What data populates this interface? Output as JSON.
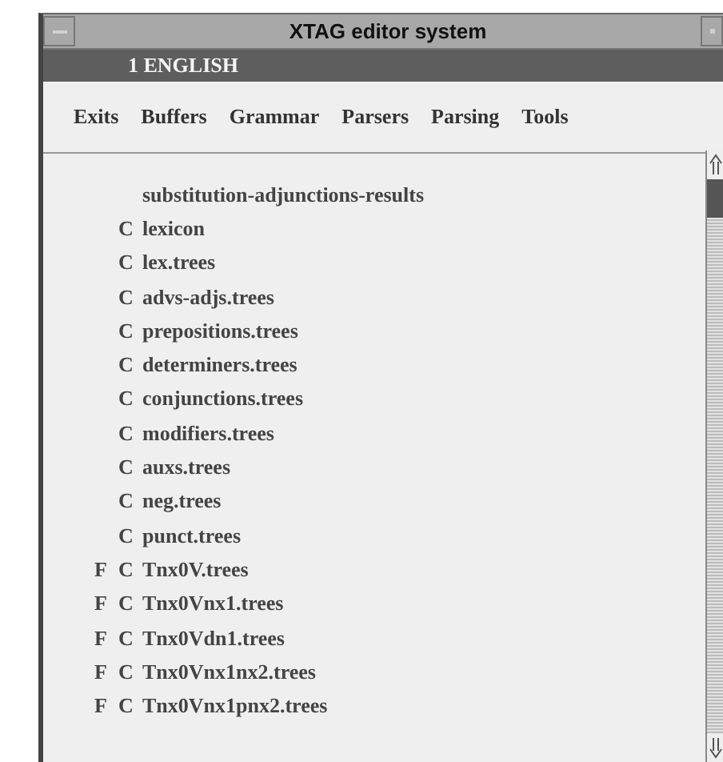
{
  "window": {
    "title": "XTAG editor system"
  },
  "buffer_bar": {
    "label": "1 ENGLISH"
  },
  "menus": [
    "Exits",
    "Buffers",
    "Grammar",
    "Parsers",
    "Parsing",
    "Tools"
  ],
  "files": [
    {
      "name": "substitution-adjunctions-results"
    },
    {
      "c": "C",
      "name": "lexicon"
    },
    {
      "c": "C",
      "name": "lex.trees"
    },
    {
      "c": "C",
      "name": "advs-adjs.trees"
    },
    {
      "c": "C",
      "name": "prepositions.trees"
    },
    {
      "c": "C",
      "name": "determiners.trees"
    },
    {
      "c": "C",
      "name": "conjunctions.trees"
    },
    {
      "c": "C",
      "name": "modifiers.trees"
    },
    {
      "c": "C",
      "name": "auxs.trees"
    },
    {
      "c": "C",
      "name": "neg.trees"
    },
    {
      "c": "C",
      "name": "punct.trees"
    },
    {
      "f": "F",
      "c": "C",
      "name": "Tnx0V.trees"
    },
    {
      "f": "F",
      "c": "C",
      "name": "Tnx0Vnx1.trees"
    },
    {
      "f": "F",
      "c": "C",
      "name": "Tnx0Vdn1.trees"
    },
    {
      "f": "F",
      "c": "C",
      "name": "Tnx0Vnx1nx2.trees"
    },
    {
      "f": "F",
      "c": "C",
      "name": "Tnx0Vnx1pnx2.trees"
    }
  ]
}
